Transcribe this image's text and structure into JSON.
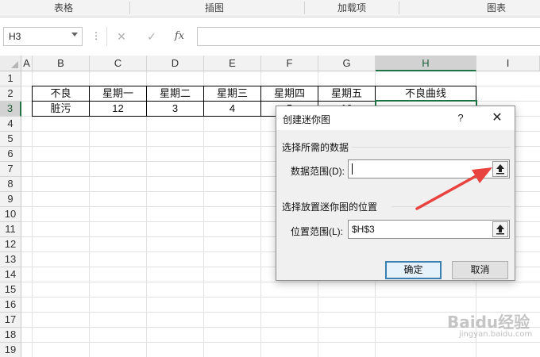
{
  "ribbon": {
    "groups": [
      "表格",
      "插图",
      "加载项",
      "图表"
    ]
  },
  "formula_bar": {
    "name_box": "H3",
    "formula": "",
    "icons": [
      "more-icon",
      "cancel-icon",
      "enter-icon",
      "fx-icon"
    ],
    "fx_label": "fx"
  },
  "sheet": {
    "columns": [
      "A",
      "B",
      "C",
      "D",
      "E",
      "F",
      "G",
      "H",
      "I"
    ],
    "rows": [
      "1",
      "2",
      "3",
      "4",
      "5",
      "6",
      "7",
      "8",
      "9",
      "10",
      "11",
      "12",
      "13",
      "14",
      "15",
      "16",
      "17",
      "18",
      "19"
    ],
    "selected_cell": "H3",
    "selected_column": "H",
    "selected_row": "3",
    "table": {
      "header": [
        "不良",
        "星期一",
        "星期二",
        "星期三",
        "星期四",
        "星期五",
        "不良曲线"
      ],
      "row": [
        "脏污",
        "12",
        "3",
        "4",
        "5",
        "10",
        ""
      ]
    }
  },
  "dialog": {
    "title": "创建迷你图",
    "help": "?",
    "close": "✕",
    "section_data": "选择所需的数据",
    "data_range_label": "数据范围(D):",
    "data_range_value": "",
    "section_location": "选择放置迷你图的位置",
    "location_range_label": "位置范围(L):",
    "location_range_value": "$H$3",
    "ok": "确定",
    "cancel": "取消"
  },
  "annotation": {
    "arrow_color": "#e8433f"
  },
  "watermark": {
    "brand": "Baidu经验",
    "url": "jingyan.baidu.com"
  },
  "colors": {
    "excel_green": "#217346",
    "dialog_bg": "#f0f0f0",
    "default_button_border": "#3c7fb1"
  }
}
